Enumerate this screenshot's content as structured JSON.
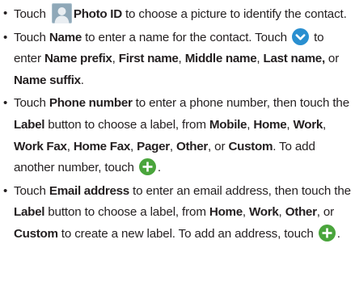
{
  "list": [
    {
      "segments": [
        {
          "t": "Touch ",
          "b": false
        },
        {
          "icon": "contact-photo-icon"
        },
        {
          "t": "Photo ID",
          "b": true
        },
        {
          "t": " to choose a picture to identify the contact.",
          "b": false
        }
      ]
    },
    {
      "segments": [
        {
          "t": "Touch ",
          "b": false
        },
        {
          "t": "Name",
          "b": true
        },
        {
          "t": " to enter a name for the contact. Touch ",
          "b": false
        },
        {
          "icon": "expand-chevron-icon"
        },
        {
          "t": " to enter ",
          "b": false
        },
        {
          "t": "Name prefix",
          "b": true
        },
        {
          "t": ", ",
          "b": false
        },
        {
          "t": "First name",
          "b": true
        },
        {
          "t": ", ",
          "b": false
        },
        {
          "t": "Middle name",
          "b": true
        },
        {
          "t": ", ",
          "b": false
        },
        {
          "t": "Last name,",
          "b": true
        },
        {
          "t": " or ",
          "b": false
        },
        {
          "t": "Name suffix",
          "b": true
        },
        {
          "t": ".",
          "b": false
        }
      ]
    },
    {
      "segments": [
        {
          "t": "Touch ",
          "b": false
        },
        {
          "t": "Phone number",
          "b": true
        },
        {
          "t": " to enter a phone number, then touch the ",
          "b": false
        },
        {
          "t": "Label",
          "b": true
        },
        {
          "t": " button to choose a label, from ",
          "b": false
        },
        {
          "t": "Mobile",
          "b": true
        },
        {
          "t": ", ",
          "b": false
        },
        {
          "t": "Home",
          "b": true
        },
        {
          "t": ", ",
          "b": false
        },
        {
          "t": "Work",
          "b": true
        },
        {
          "t": ", ",
          "b": false
        },
        {
          "t": "Work Fax",
          "b": true
        },
        {
          "t": ", ",
          "b": false
        },
        {
          "t": "Home Fax",
          "b": true
        },
        {
          "t": ", ",
          "b": false
        },
        {
          "t": "Pager",
          "b": true
        },
        {
          "t": ", ",
          "b": false
        },
        {
          "t": "Other",
          "b": true
        },
        {
          "t": ", or ",
          "b": false
        },
        {
          "t": "Custom",
          "b": true
        },
        {
          "t": ". To add another number, touch ",
          "b": false
        },
        {
          "icon": "add-icon"
        },
        {
          "t": ".",
          "b": false
        }
      ]
    },
    {
      "segments": [
        {
          "t": "Touch ",
          "b": false
        },
        {
          "t": "Email address",
          "b": true
        },
        {
          "t": " to enter an email address, then touch the ",
          "b": false
        },
        {
          "t": "Label",
          "b": true
        },
        {
          "t": " button to choose a label, from ",
          "b": false
        },
        {
          "t": "Home",
          "b": true
        },
        {
          "t": ", ",
          "b": false
        },
        {
          "t": "Work",
          "b": true
        },
        {
          "t": ", ",
          "b": false
        },
        {
          "t": "Other",
          "b": true
        },
        {
          "t": ", or ",
          "b": false
        },
        {
          "t": "Custom",
          "b": true
        },
        {
          "t": " to create a new label. To add an address, touch ",
          "b": false
        },
        {
          "icon": "add-icon"
        },
        {
          "t": ".",
          "b": false
        }
      ]
    }
  ],
  "colors": {
    "text": "#231f20",
    "chevron_circle": "#2a8fd0",
    "add_circle": "#4aa53c",
    "photo_bg": "#a9bfcc"
  }
}
